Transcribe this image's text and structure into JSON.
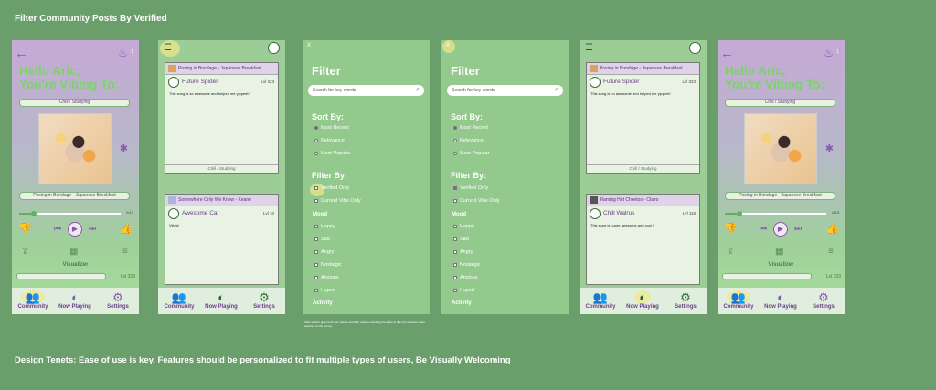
{
  "page": {
    "title": "Filter Community Posts By Verified",
    "tenets": "Design Tenets: Ease of use is key, Features should be personalized to fit multiple types of users, Be Visually Welcoming",
    "footnote": "Filter section gives both sort options and filter options including the ability to filter the answers users selected on the survey."
  },
  "home": {
    "greeting_line1": "Hello Aric,",
    "greeting_line2": "You're Vibing To:",
    "vibe": "Chill / Studying",
    "song": "Posing in Bondage - Japanese Breakfast",
    "time": "0:13",
    "progress": 0.12,
    "visualizer": "Visualizer",
    "level": "Lvl 323",
    "streak": "1"
  },
  "nav": {
    "community": "Community",
    "now_playing": "Now Playing",
    "settings": "Settings"
  },
  "feed1": {
    "post1": {
      "song": "Posing in Bondage - Japanese Breakfast",
      "user": "Future Spider",
      "level": "Lvl 323",
      "text": "This song is so awesome and helped me ylppeet!",
      "tag": "Chill / Studying"
    },
    "post2": {
      "song": "Somewhere Only We Know - Keane",
      "user": "Awesome Cat",
      "level": "Lvl 10",
      "text": "Vibes!"
    }
  },
  "feed2": {
    "post1": {
      "song": "Posing in Bondage - Japanese Breakfast",
      "user": "Future Spider",
      "level": "Lvl 323",
      "text": "This song is so awesome and helped me ylppeet!",
      "tag": "Chill / Studying"
    },
    "post2": {
      "song": "Flaming Hot Cheetos - Clairo",
      "user": "Chill Walrus",
      "level": "Lvl 118",
      "text": "This song is super awesome and cool !"
    }
  },
  "filter": {
    "close": "X",
    "title": "Filter",
    "search_placeholder": "Search for key-words",
    "sort_by": "Sort By:",
    "sort_options": [
      "Most Recent",
      "Relevance",
      "Most Popular"
    ],
    "filter_by": "Filter By:",
    "filter_options": [
      "Verified Only",
      "Current Vibe Only"
    ],
    "mood": "Mood",
    "mood_options": [
      "Happy",
      "Sad",
      "Angry",
      "Nostalgic",
      "Anxious",
      "Hyped"
    ],
    "activity": "Activity"
  }
}
